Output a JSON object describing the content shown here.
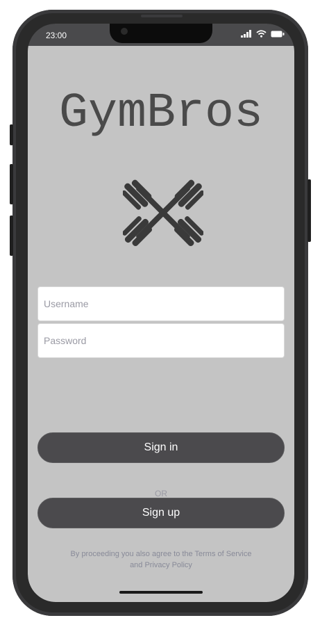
{
  "status_bar": {
    "time": "23:00",
    "icons": [
      "signal-icon",
      "wifi-icon",
      "battery-icon"
    ]
  },
  "app": {
    "title": "GymBros",
    "logo": "crossed-dumbbells-icon"
  },
  "form": {
    "username_placeholder": "Username",
    "password_placeholder": "Password"
  },
  "actions": {
    "sign_in_label": "Sign in",
    "separator": "OR",
    "sign_up_label": "Sign up"
  },
  "legal": {
    "line1": "By proceeding you also agree to the Terms of Service",
    "line2": "and Privacy Policy"
  },
  "colors": {
    "background": "#c4c4c4",
    "button": "#4b4a4d",
    "title": "#4a4a4a"
  }
}
